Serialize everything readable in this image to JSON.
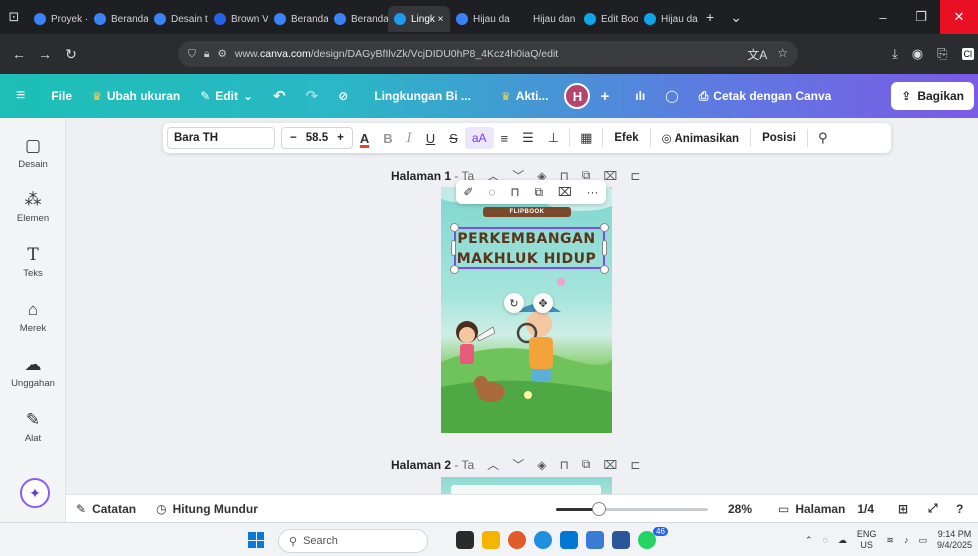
{
  "browser": {
    "tabs": [
      {
        "label": "Proyek ·",
        "color": "#3b82f6",
        "active": false
      },
      {
        "label": "Beranda",
        "color": "#3b82f6",
        "active": false
      },
      {
        "label": "Desain t",
        "color": "#3b82f6",
        "active": false
      },
      {
        "label": "Brown V",
        "color": "#2563eb",
        "active": false
      },
      {
        "label": "Beranda",
        "color": "#3b82f6",
        "active": false
      },
      {
        "label": "Beranda",
        "color": "#3b82f6",
        "active": false
      },
      {
        "label": "Lingk ×",
        "color": "#1d9bf0",
        "active": true
      },
      {
        "label": "Hijau da",
        "color": "#3b82f6",
        "active": false
      },
      {
        "label": "Hijau dan Ki",
        "color": "#1e1f22",
        "active": false
      },
      {
        "label": "Edit Boo",
        "color": "#0ea5e9",
        "active": false
      },
      {
        "label": "Hijau da",
        "color": "#0ea5e9",
        "active": false
      }
    ],
    "url_prefix": "www.",
    "url_domain": "canva.com",
    "url_path": "/design/DAGyBfIlvZk/VcjDIDU0hP8_4Kcz4h0iaQ/edit",
    "profile_label": "Cl"
  },
  "canva": {
    "file_label": "File",
    "resize_label": "Ubah ukuran",
    "edit_label": "Edit",
    "design_title": "Lingkungan Bi ...",
    "activity_label": "Akti...",
    "avatar_initial": "H",
    "print_label": "Cetak dengan Canva",
    "share_label": "Bagikan"
  },
  "sidebar": {
    "items": [
      {
        "label": "Desain",
        "icon": "layout-icon"
      },
      {
        "label": "Elemen",
        "icon": "elements-icon"
      },
      {
        "label": "Teks",
        "icon": "text-icon"
      },
      {
        "label": "Merek",
        "icon": "brand-icon"
      },
      {
        "label": "Unggahan",
        "icon": "upload-icon"
      },
      {
        "label": "Alat",
        "icon": "tools-icon"
      }
    ]
  },
  "text_toolbar": {
    "font": "Bara TH",
    "size": "58.5",
    "effects_label": "Efek",
    "animate_label": "Animasikan",
    "position_label": "Posisi"
  },
  "page1": {
    "label": "Halaman 1",
    "subtitle": "- Ta",
    "ribbon": "FLIPBOOK",
    "title_line1": "PERKEMBANGAN",
    "title_line2": "MAKHLUK HIDUP"
  },
  "page2": {
    "label": "Halaman 2",
    "subtitle": "- Ta"
  },
  "bottom": {
    "notes_label": "Catatan",
    "timer_label": "Hitung Mundur",
    "zoom": "28%",
    "zoom_fraction": 0.28,
    "pages_label": "Halaman",
    "page_count": "1/4"
  },
  "taskbar": {
    "search_placeholder": "Search",
    "lang_top": "ENG",
    "lang_bottom": "US",
    "time": "9:14 PM",
    "date": "9/4/2025",
    "badge": "46"
  }
}
